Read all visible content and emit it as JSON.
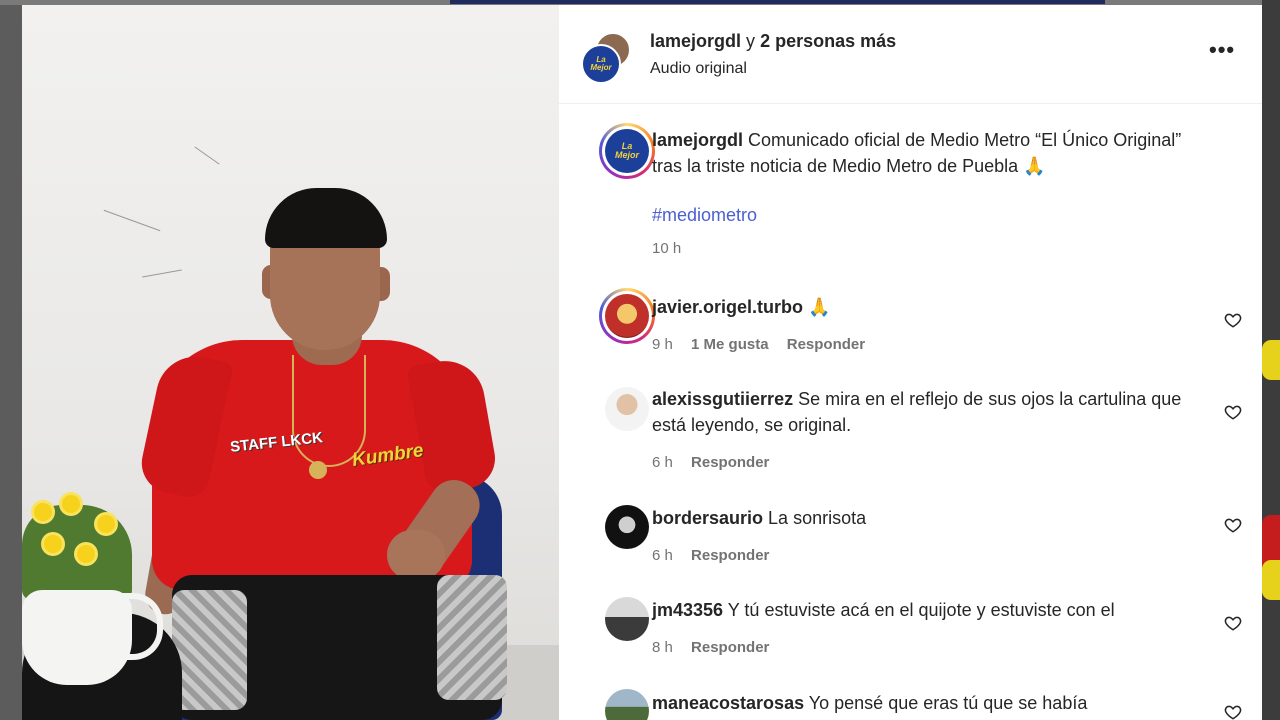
{
  "header": {
    "username": "lamejorgdl",
    "connector": "y",
    "others": "2 personas más",
    "subtitle": "Audio original",
    "more_icon": "more-horizontal-icon"
  },
  "video": {
    "shirt_logo_left": "STAFF LKCK",
    "shirt_logo_right": "Kumbre"
  },
  "caption": {
    "username": "lamejorgdl",
    "text": "Comunicado oficial de Medio Metro “El Único Original” tras la triste noticia de Medio Metro de Puebla 🙏",
    "hashtag": "#mediometro",
    "time": "10 h"
  },
  "comments": [
    {
      "username": "javier.origel.turbo",
      "text": "🙏",
      "time": "9 h",
      "likes": "1 Me gusta",
      "reply": "Responder"
    },
    {
      "username": "alexissgutiierrez",
      "text": "Se mira en el reflejo de sus ojos la cartulina que está leyendo, se original.",
      "time": "6 h",
      "reply": "Responder"
    },
    {
      "username": "bordersaurio",
      "text": "La sonrisota",
      "time": "6 h",
      "reply": "Responder"
    },
    {
      "username": "jm43356",
      "text": "Y tú estuviste acá en el quijote y estuviste con el",
      "time": "8 h",
      "reply": "Responder"
    },
    {
      "username": "maneacostarosas",
      "text": "Yo pensé que eras tú que se había"
    }
  ],
  "colors": {
    "hashtag": "#4a5fd0",
    "meta_text": "#737373",
    "brand_blue": "#1c3f99"
  }
}
